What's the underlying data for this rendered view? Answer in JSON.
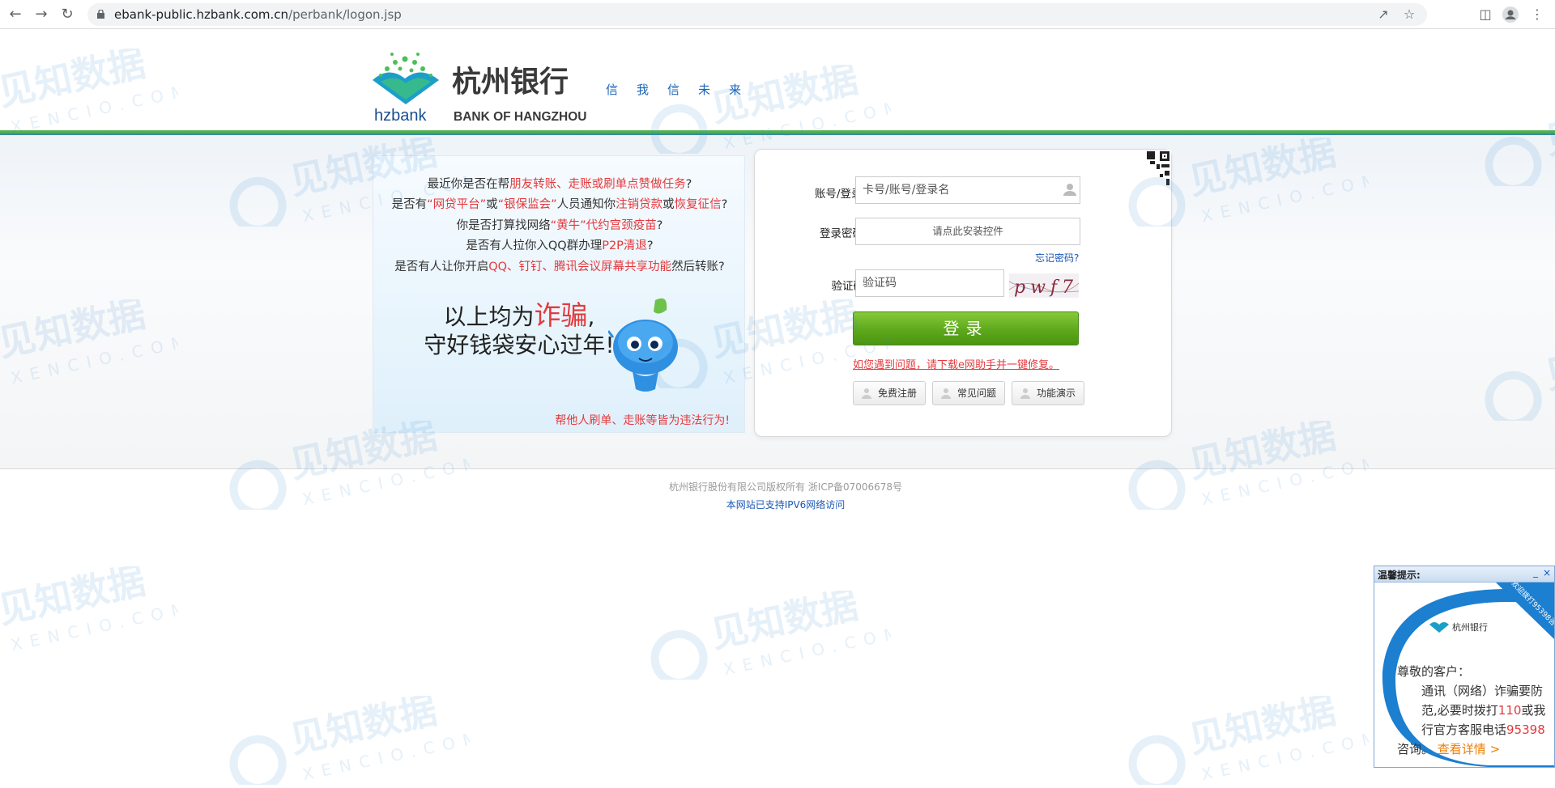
{
  "browser": {
    "url_domain": "ebank-public.hzbank.com.cn",
    "url_path": "/perbank/logon.jsp"
  },
  "header": {
    "bank_name_cn": "杭州银行",
    "bank_name_en": "BANK OF HANGZHOU",
    "logo_text": "hzbank",
    "slogan": "信我信未来"
  },
  "warning": {
    "line1": [
      {
        "t": "最近你是否在帮",
        "red": false
      },
      {
        "t": "朋友转账、走账或刷单点赞做任务",
        "red": true
      },
      {
        "t": "?",
        "red": false
      }
    ],
    "line2": [
      {
        "t": "是否有",
        "red": false
      },
      {
        "t": "“网贷平台”",
        "red": true
      },
      {
        "t": "或",
        "red": false
      },
      {
        "t": "“银保监会”",
        "red": true
      },
      {
        "t": "人员通知你",
        "red": false
      },
      {
        "t": "注销贷款",
        "red": true
      },
      {
        "t": "或",
        "red": false
      },
      {
        "t": "恢复征信",
        "red": true
      },
      {
        "t": "?",
        "red": false
      }
    ],
    "line3": [
      {
        "t": "你是否打算找网络",
        "red": false
      },
      {
        "t": "“黄牛”代约宫颈疫苗",
        "red": true
      },
      {
        "t": "?",
        "red": false
      }
    ],
    "line4": [
      {
        "t": "是否有人拉你入QQ群办理",
        "red": false
      },
      {
        "t": "P2P清退",
        "red": true
      },
      {
        "t": "?",
        "red": false
      }
    ],
    "line5": [
      {
        "t": "是否有人让你开启",
        "red": false
      },
      {
        "t": "QQ、钉钉、腾讯会议屏幕共享功能",
        "red": true
      },
      {
        "t": "然后转账?",
        "red": false
      }
    ],
    "big1_prefix": "以上均为",
    "big1_red": "诈骗",
    "big1_suffix": ",",
    "big2": "守好钱袋安心过年!",
    "footer": "帮他人刷单、走账等皆为违法行为!"
  },
  "login": {
    "account_label": "账号/登录名",
    "account_placeholder": "卡号/账号/登录名",
    "password_label": "登录密码",
    "password_hint": "请点此安装控件",
    "forgot": "忘记密码?",
    "captcha_label": "验证码",
    "captcha_placeholder": "验证码",
    "captcha_text": "pwf7",
    "submit": "登录",
    "fix_link": "如您遇到问题，请下载e网助手并一键修复。",
    "buttons": [
      "免费注册",
      "常见问题",
      "功能演示"
    ]
  },
  "footer": {
    "copyright": "杭州银行股份有限公司版权所有 浙ICP备07006678号",
    "ipv6": "本网站已支持IPV6网络访问"
  },
  "watermark": {
    "cn": "见知数据",
    "en": "XENCIO.COM"
  },
  "popup": {
    "title": "温馨提示:",
    "minimize": "_",
    "close": "×",
    "banner": "欢迎拨打95398咨询",
    "bank_name": "杭州银行",
    "greeting": "尊敬的客户：",
    "body_a": "通讯（网络）诈骗要防范,必要时拨打",
    "num1": "110",
    "body_b": "或我行官方客服电话",
    "num2": "95398",
    "body_c": "咨询。",
    "more": "查看详情 >"
  },
  "colors": {
    "brand_green": "#5ea81c",
    "brand_blue": "#1a63b8",
    "alert_red": "#e4393c"
  }
}
